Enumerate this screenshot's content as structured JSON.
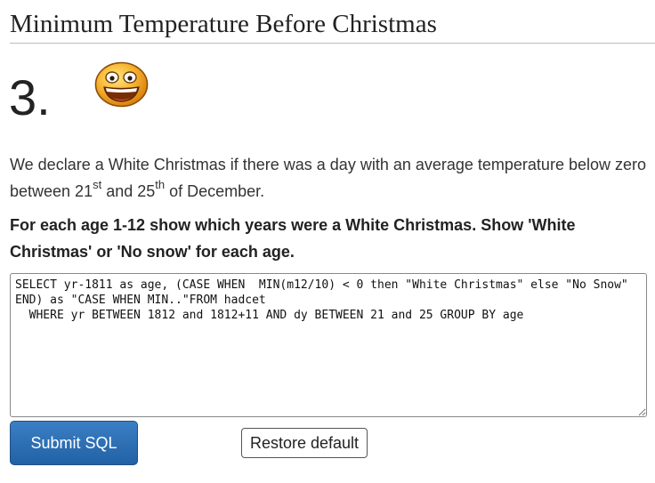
{
  "page": {
    "title": "Minimum Temperature Before Christmas"
  },
  "question": {
    "number": "3.",
    "icon": "grinning-smiley-icon",
    "description": {
      "before_21": "We declare a White Christmas if there was a day with an average temperature below zero between 21",
      "sup1": "st",
      "between": " and 25",
      "sup2": "th",
      "after": " of December."
    },
    "task": "For each age 1-12 show which years were a White Christmas. Show 'White Christmas' or 'No snow' for each age."
  },
  "editor": {
    "sql": "SELECT yr-1811 as age, (CASE WHEN  MIN(m12/10) < 0 then \"White Christmas\" else \"No Snow\" END) as \"CASE WHEN MIN..\"FROM hadcet\n  WHERE yr BETWEEN 1812 and 1812+11 AND dy BETWEEN 21 and 25 GROUP BY age"
  },
  "buttons": {
    "submit_label": "Submit SQL",
    "restore_label": "Restore default"
  },
  "colors": {
    "submit_bg": "#2a6db3",
    "smiley_face": "#f5a623"
  }
}
